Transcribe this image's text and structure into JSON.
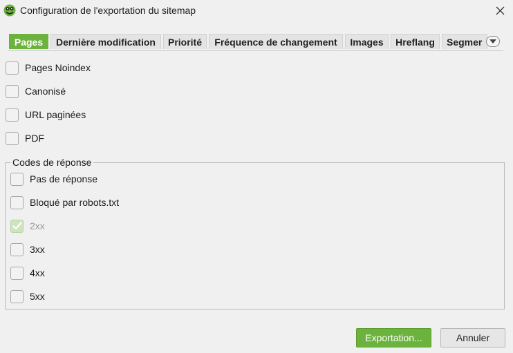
{
  "window": {
    "title": "Configuration de l'exportation du sitemap",
    "icon": "frog-logo-icon",
    "close_icon": "close-icon"
  },
  "tabs": [
    {
      "label": "Pages",
      "active": true
    },
    {
      "label": "Dernière modification",
      "active": false
    },
    {
      "label": "Priorité",
      "active": false
    },
    {
      "label": "Fréquence de changement",
      "active": false
    },
    {
      "label": "Images",
      "active": false
    },
    {
      "label": "Hreflang",
      "active": false
    },
    {
      "label": "Segmer",
      "active": false
    }
  ],
  "tab_overflow_icon": "chevron-down-icon",
  "options": [
    {
      "label": "Pages Noindex",
      "checked": false
    },
    {
      "label": "Canonisé",
      "checked": false
    },
    {
      "label": "URL paginées",
      "checked": false
    },
    {
      "label": "PDF",
      "checked": false
    }
  ],
  "response_codes": {
    "title": "Codes de réponse",
    "items": [
      {
        "label": "Pas de réponse",
        "checked": false,
        "disabled": false
      },
      {
        "label": "Bloqué par robots.txt",
        "checked": false,
        "disabled": false
      },
      {
        "label": "2xx",
        "checked": true,
        "disabled": true
      },
      {
        "label": "3xx",
        "checked": false,
        "disabled": false
      },
      {
        "label": "4xx",
        "checked": false,
        "disabled": false
      },
      {
        "label": "5xx",
        "checked": false,
        "disabled": false
      }
    ]
  },
  "buttons": {
    "export": "Exportation...",
    "cancel": "Annuler"
  },
  "colors": {
    "accent": "#6cb33e",
    "background": "#f0f0f0"
  }
}
